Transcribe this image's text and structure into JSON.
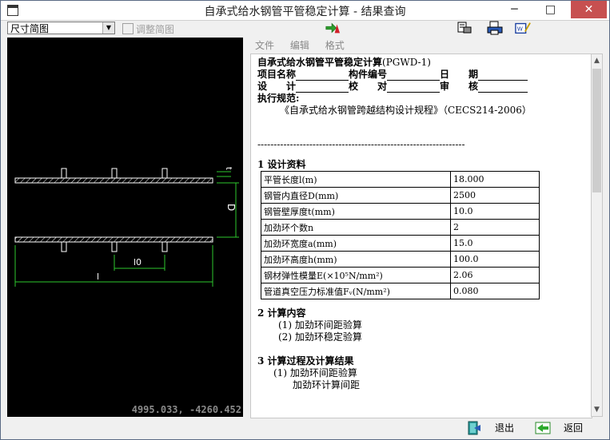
{
  "window": {
    "title": "自承式给水钢管平管稳定计算 - 结果查询",
    "minimize": "─",
    "maximize": "□",
    "close": "✕"
  },
  "toolbar": {
    "view_select": "尺寸简图",
    "adjust_label": "调整简图",
    "icons": [
      "arrow-icon",
      "print-preview-icon",
      "print-icon",
      "edit-icon"
    ]
  },
  "menu": [
    "文件",
    "编辑",
    "格式"
  ],
  "drawing": {
    "coords": "4995.033, -4260.452",
    "labels": {
      "t": "t",
      "D": "D",
      "l0": "l0",
      "l": "l"
    }
  },
  "doc": {
    "title_main": "自承式给水钢管平管稳定计算",
    "title_code": "(PGWD-1)",
    "row1": {
      "a": "项目名称",
      "b": "构件编号",
      "c": "日　　期"
    },
    "row2": {
      "a": "设　　计",
      "b": "校　　对",
      "c": "审　　核"
    },
    "spec_label": "执行规范:",
    "spec_text": "《自承式给水钢管跨越结构设计规程》（CECS214-2006）",
    "dash_line": "----------------------------------------------------------------",
    "section1": "1  设计资料",
    "params": [
      {
        "k": "平管长度l(m)",
        "v": "18.000"
      },
      {
        "k": "钢管内直径D(mm)",
        "v": "2500"
      },
      {
        "k": "钢管壁厚度t(mm)",
        "v": "10.0"
      },
      {
        "k": "加劲环个数n",
        "v": "2"
      },
      {
        "k": "加劲环宽度a(mm)",
        "v": "15.0"
      },
      {
        "k": "加劲环高度h(mm)",
        "v": "100.0"
      },
      {
        "k": "钢材弹性模量E(×10⁵N/mm²)",
        "v": "2.06"
      },
      {
        "k": "管道真空压力标准值Fᵥ(N/mm²)",
        "v": "0.080"
      }
    ],
    "section2": "2  计算内容",
    "items2": [
      "(1) 加劲环间距验算",
      "(2) 加劲环稳定验算"
    ],
    "section3": "3  计算过程及计算结果",
    "items3": [
      "(1) 加劲环间距验算",
      "加劲环计算间距"
    ]
  },
  "bottom": {
    "exit_label": "退出",
    "back_label": "返回"
  }
}
